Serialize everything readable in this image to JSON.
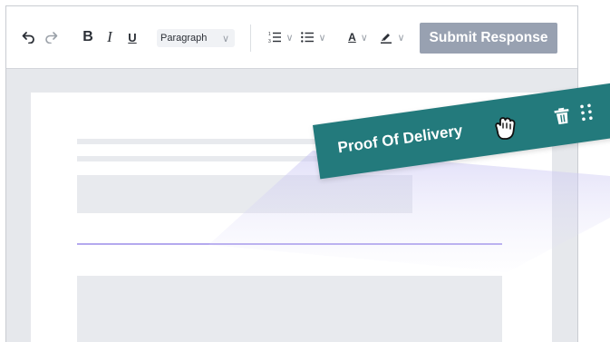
{
  "toolbar": {
    "undo_icon": "undo-icon",
    "redo_icon": "redo-icon",
    "bold_label": "B",
    "italic_label": "I",
    "underline_label": "U",
    "paragraph_select": {
      "value": "Paragraph"
    },
    "ordered_list_icon": "ordered-list-icon",
    "bullet_list_icon": "bullet-list-icon",
    "text_color_label": "A",
    "highlight_icon": "highlight-pen-icon",
    "submit_label": "Submit Response"
  },
  "drag_card": {
    "title": "Proof Of Delivery",
    "trash_icon": "trash-icon",
    "grip_icon": "drag-grip-icon",
    "cursor_icon": "grab-hand-cursor-icon"
  },
  "colors": {
    "card_teal": "#237a7c",
    "submit_bg": "#98a1b1",
    "divider_line": "#b4a9ee",
    "placeholder": "#e8eaee"
  }
}
